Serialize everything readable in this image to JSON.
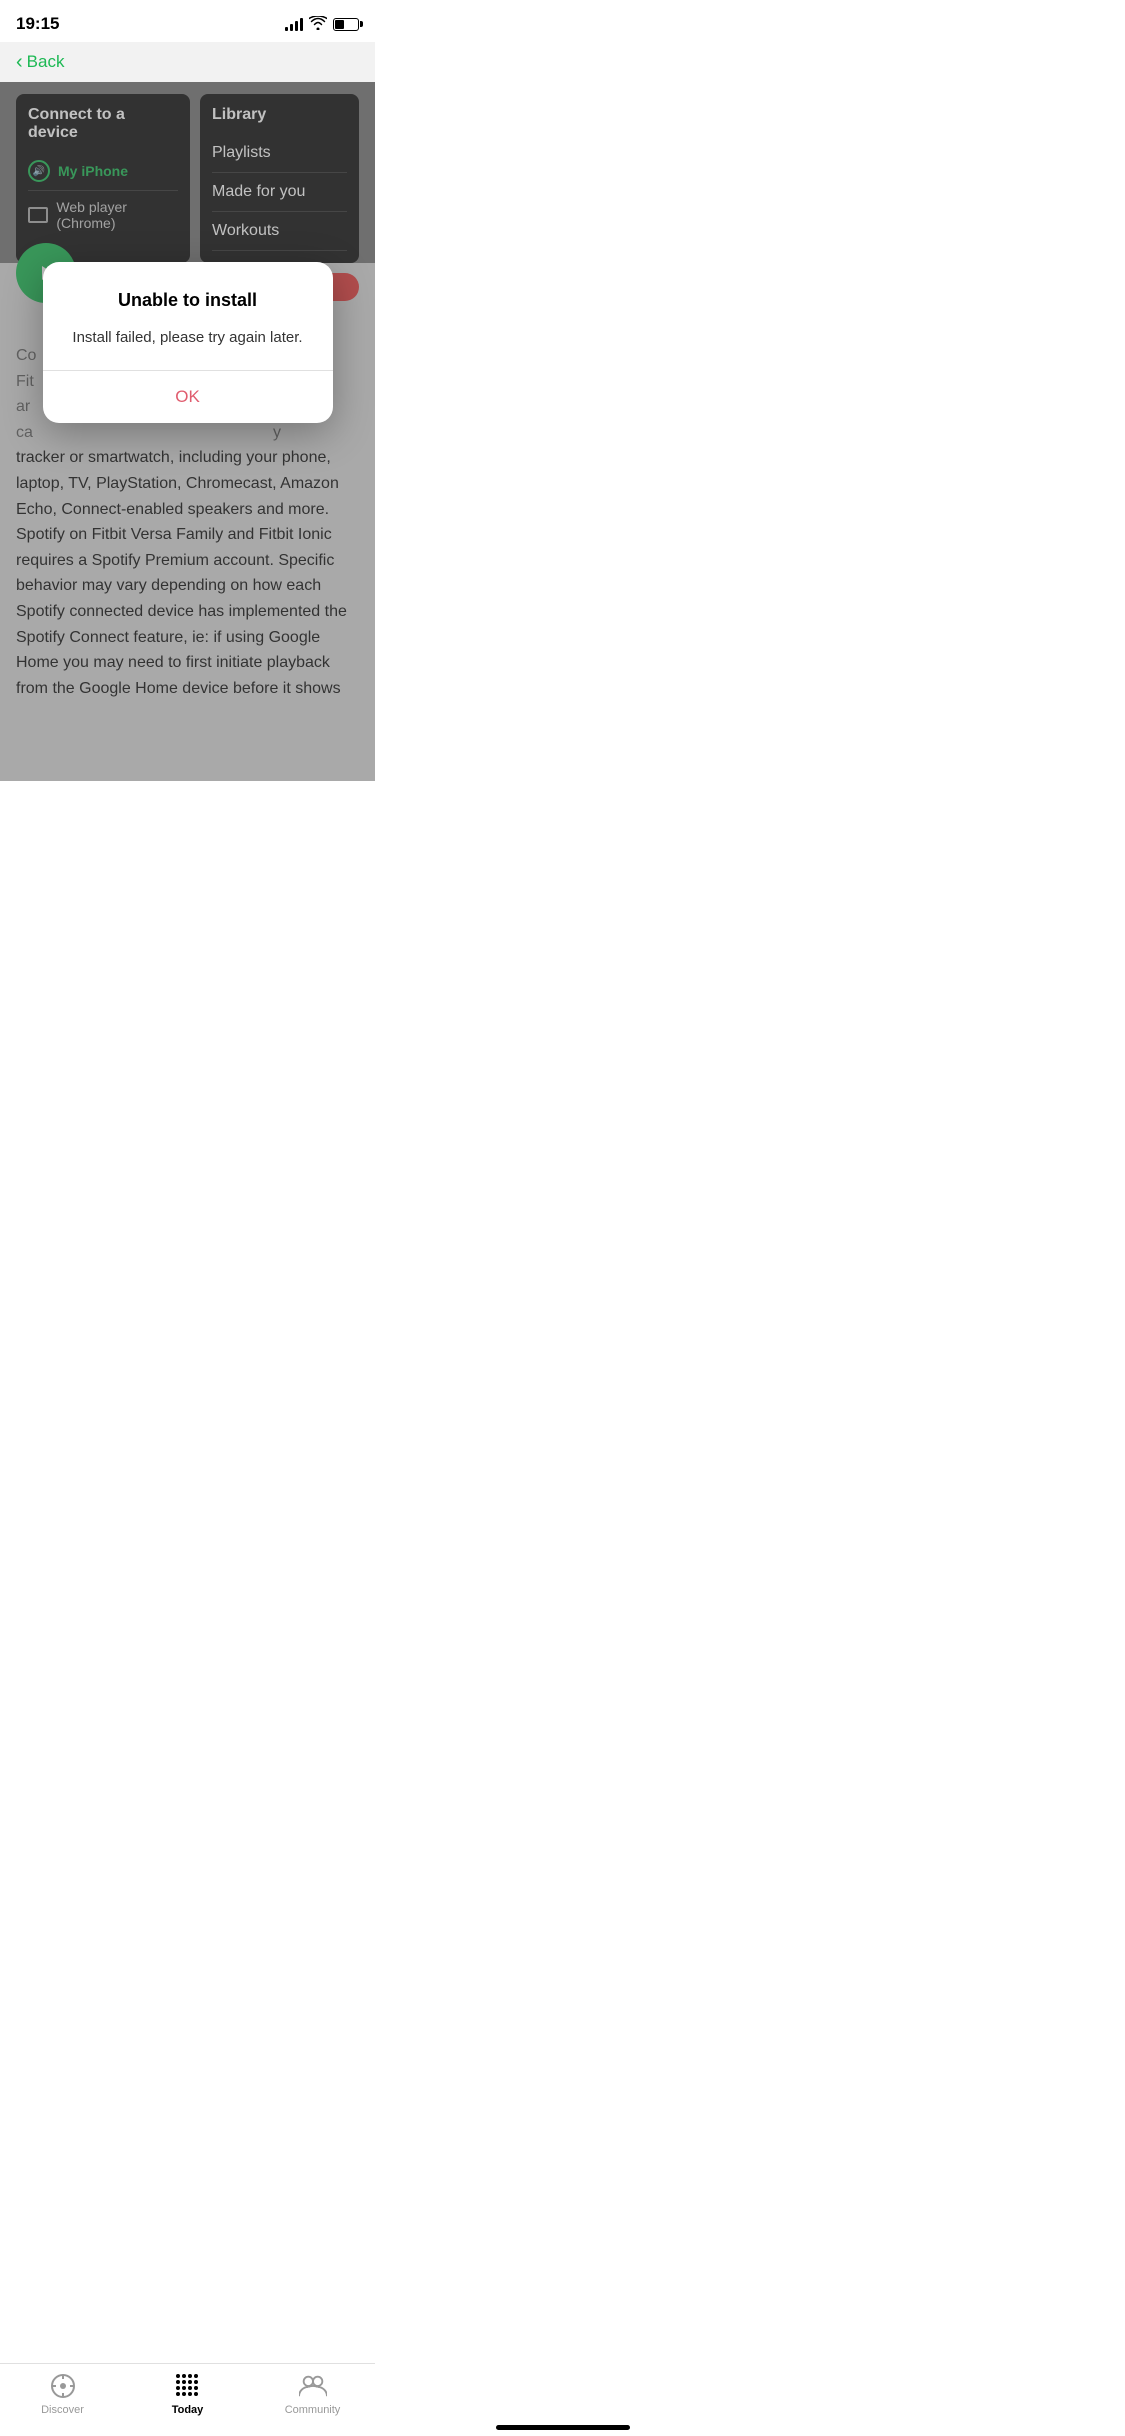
{
  "statusBar": {
    "time": "19:15"
  },
  "nav": {
    "backLabel": "Back"
  },
  "screenshots": {
    "left": {
      "title": "Connect to a device",
      "activeDevice": "My iPhone",
      "secondaryDevice": "Web player (Chrome)"
    },
    "right": {
      "title": "Library",
      "items": [
        "Playlists",
        "Made for you",
        "Workouts"
      ]
    }
  },
  "modal": {
    "title": "Unable to install",
    "message": "Install failed, please try again later.",
    "okLabel": "OK"
  },
  "bodyText": "Co                                         on\nFit                                          re\nar\nca                                           y\ntracker or smartwatch, including your phone, laptop, TV, PlayStation, Chromecast, Amazon Echo, Connect-enabled speakers and more. Spotify on Fitbit Versa Family and Fitbit Ionic requires a Spotify Premium account. Specific behavior may vary depending on how each Spotify connected device has implemented the Spotify Connect feature, ie: if using Google Home you may need to first initiate playback from the Google Home device before it shows",
  "tabBar": {
    "items": [
      {
        "id": "discover",
        "label": "Discover"
      },
      {
        "id": "today",
        "label": "Today"
      },
      {
        "id": "community",
        "label": "Community"
      }
    ],
    "activeTab": "today"
  }
}
